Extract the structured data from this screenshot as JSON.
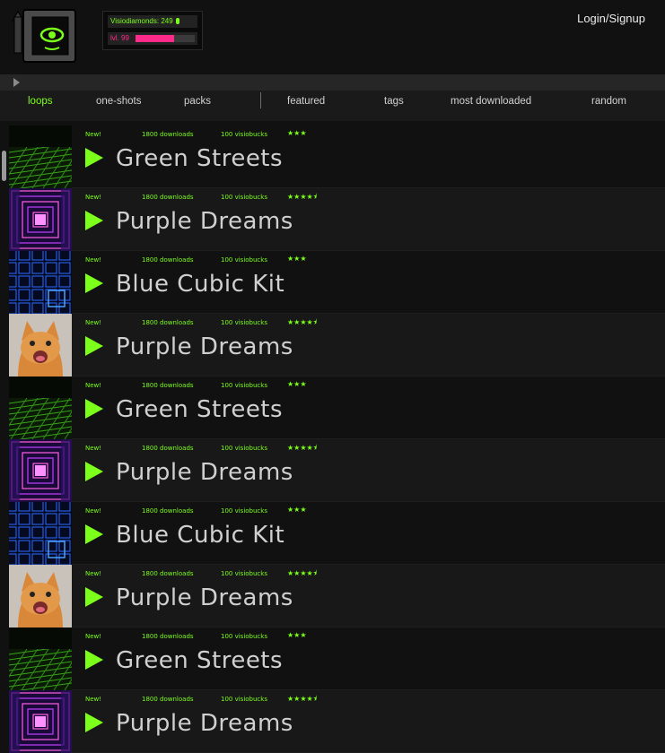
{
  "header": {
    "login_label": "Login/Signup",
    "diamonds_label": "Visiodiamonds: 249",
    "level_label": "lvl. 99",
    "level_progress": 0.65,
    "accent_color": "#7cff1a",
    "level_color": "#ff2a8a"
  },
  "nav": {
    "items": [
      {
        "label": "loops",
        "active": true
      },
      {
        "label": "one-shots",
        "active": false
      },
      {
        "label": "packs",
        "active": false
      },
      {
        "label": "featured",
        "active": false
      },
      {
        "label": "tags",
        "active": false
      },
      {
        "label": "most downloaded",
        "active": false
      },
      {
        "label": "random",
        "active": false
      }
    ]
  },
  "items": [
    {
      "title": "Green Streets",
      "badge": "New!",
      "downloads": "1800 downloads",
      "price": "100 visiobucks",
      "stars": "★★★",
      "thumb": "green-grid"
    },
    {
      "title": "Purple Dreams",
      "badge": "New!",
      "downloads": "1800 downloads",
      "price": "100 visiobucks",
      "stars": "★★★★⯨",
      "thumb": "purple-tunnel"
    },
    {
      "title": "Blue Cubic Kit",
      "badge": "New!",
      "downloads": "1800 downloads",
      "price": "100 visiobucks",
      "stars": "★★★",
      "thumb": "blue-cubes"
    },
    {
      "title": "Purple Dreams",
      "badge": "New!",
      "downloads": "1800 downloads",
      "price": "100 visiobucks",
      "stars": "★★★★⯨",
      "thumb": "cat"
    },
    {
      "title": "Green Streets",
      "badge": "New!",
      "downloads": "1800 downloads",
      "price": "100 visiobucks",
      "stars": "★★★",
      "thumb": "green-grid"
    },
    {
      "title": "Purple Dreams",
      "badge": "New!",
      "downloads": "1800 downloads",
      "price": "100 visiobucks",
      "stars": "★★★★⯨",
      "thumb": "purple-tunnel"
    },
    {
      "title": "Blue Cubic Kit",
      "badge": "New!",
      "downloads": "1800 downloads",
      "price": "100 visiobucks",
      "stars": "★★★",
      "thumb": "blue-cubes"
    },
    {
      "title": "Purple Dreams",
      "badge": "New!",
      "downloads": "1800 downloads",
      "price": "100 visiobucks",
      "stars": "★★★★⯨",
      "thumb": "cat"
    },
    {
      "title": "Green Streets",
      "badge": "New!",
      "downloads": "1800 downloads",
      "price": "100 visiobucks",
      "stars": "★★★",
      "thumb": "green-grid"
    },
    {
      "title": "Purple Dreams",
      "badge": "New!",
      "downloads": "1800 downloads",
      "price": "100 visiobucks",
      "stars": "★★★★⯨",
      "thumb": "purple-tunnel"
    }
  ]
}
